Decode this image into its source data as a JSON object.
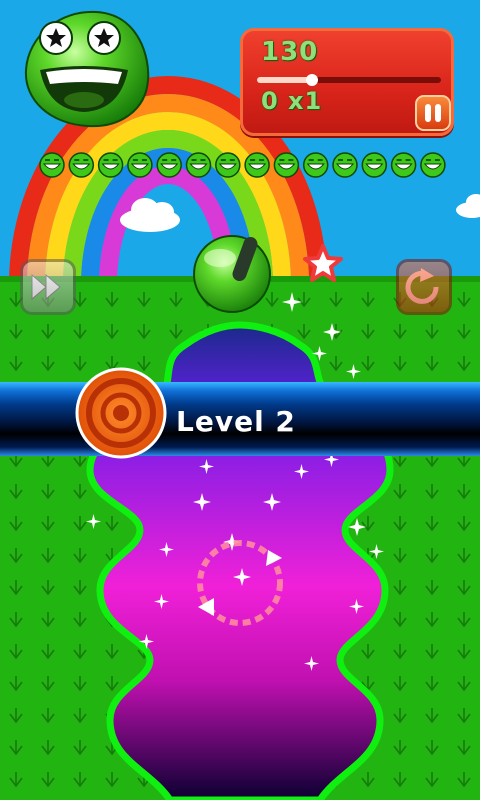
{
  "hud": {
    "score": "130",
    "combo": "0 x1",
    "level_progress": 0.3
  },
  "level_banner": {
    "text": "Level 2"
  },
  "remaining_balls": 14,
  "colors": {
    "sky": "#1aa8e8",
    "grass": "#22b512",
    "hud_red": "#e0281a",
    "score_green": "#8ee07a",
    "cave_top": "#7a1ee0",
    "cave_mid": "#f020d0",
    "banner_blue": "#0a4ab8"
  },
  "icons": {
    "fast_forward": "fast-forward-icon",
    "restart": "restart-icon",
    "pause": "pause-icon",
    "level_target": "target-icon",
    "mascot": "green-smiley-icon"
  }
}
